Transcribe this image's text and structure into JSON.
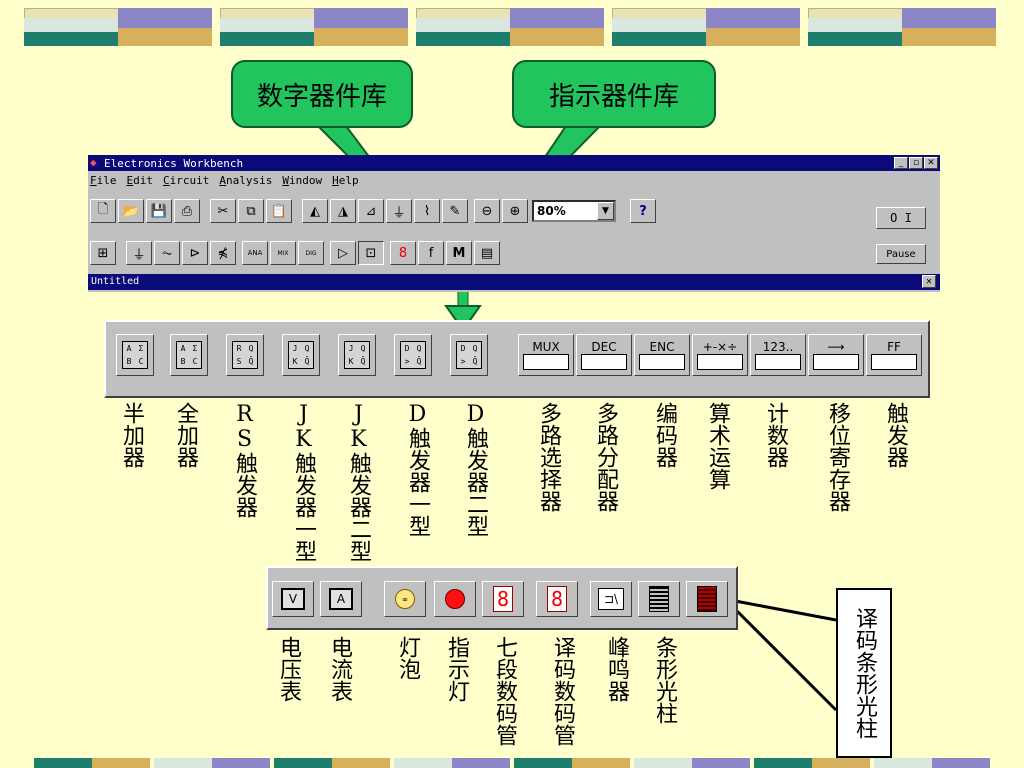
{
  "callouts": {
    "digital_lib": "数字器件库",
    "indicator_lib": "指示器件库",
    "decoded_bar": "译码条形光柱"
  },
  "window": {
    "title": "Electronics Workbench",
    "menu": [
      "File",
      "Edit",
      "Circuit",
      "Analysis",
      "Window",
      "Help"
    ],
    "zoom": "80%",
    "help_label": "?",
    "switch_label": "O I",
    "pause_label": "Pause",
    "document_title": "Untitled",
    "doc_close": "✕",
    "min": "_",
    "max": "▫",
    "close": "✕"
  },
  "digital_parts": [
    {
      "chip": [
        "A",
        "Σ",
        "B",
        "C"
      ],
      "label": "半加器"
    },
    {
      "chip": [
        "A",
        "Σ",
        "B",
        "C"
      ],
      "label": "全加器"
    },
    {
      "chip": [
        "R",
        "Q",
        "S",
        "Q̄"
      ],
      "label": "RS触发器"
    },
    {
      "chip": [
        "J",
        "Q",
        "K",
        "Q̄"
      ],
      "label": "JK触发器一型"
    },
    {
      "chip": [
        "J",
        "Q",
        "K",
        "Q̄"
      ],
      "label": "JK触发器二型"
    },
    {
      "chip": [
        "D",
        "Q",
        ">",
        "Q̄"
      ],
      "label": "D触发器一型"
    },
    {
      "chip": [
        "D",
        "Q",
        ">",
        "Q̄"
      ],
      "label": "D触发器二型"
    }
  ],
  "function_parts": [
    {
      "tag": "MUX",
      "label": "多路选择器"
    },
    {
      "tag": "DEC",
      "label": "多路分配器"
    },
    {
      "tag": "ENC",
      "label": "编码器"
    },
    {
      "tag": "+-×÷",
      "label": "算术运算"
    },
    {
      "tag": "123..",
      "label": "计数器"
    },
    {
      "tag": "⟶",
      "label": "移位寄存器"
    },
    {
      "tag": "FF",
      "label": "触发器"
    }
  ],
  "indicator_parts": [
    {
      "kind": "meter",
      "glyph": "V",
      "label": "电压表"
    },
    {
      "kind": "meter",
      "glyph": "A",
      "label": "电流表"
    },
    {
      "kind": "bulb",
      "glyph": "∞",
      "label": "灯泡"
    },
    {
      "kind": "led",
      "glyph": "",
      "label": "指示灯"
    },
    {
      "kind": "seg",
      "glyph": "8",
      "label": "七段数码管"
    },
    {
      "kind": "seg",
      "glyph": "8",
      "label": "译码数码管"
    },
    {
      "kind": "buzz",
      "glyph": "⊐\\",
      "label": "峰鸣器"
    },
    {
      "kind": "bar",
      "glyph": "",
      "label": "条形光柱"
    },
    {
      "kind": "barred",
      "glyph": "",
      "label": ""
    }
  ],
  "colors": {
    "background": "#ffffcc",
    "callout_fill": "#22c45e",
    "title_bar": "#0a0a78"
  }
}
